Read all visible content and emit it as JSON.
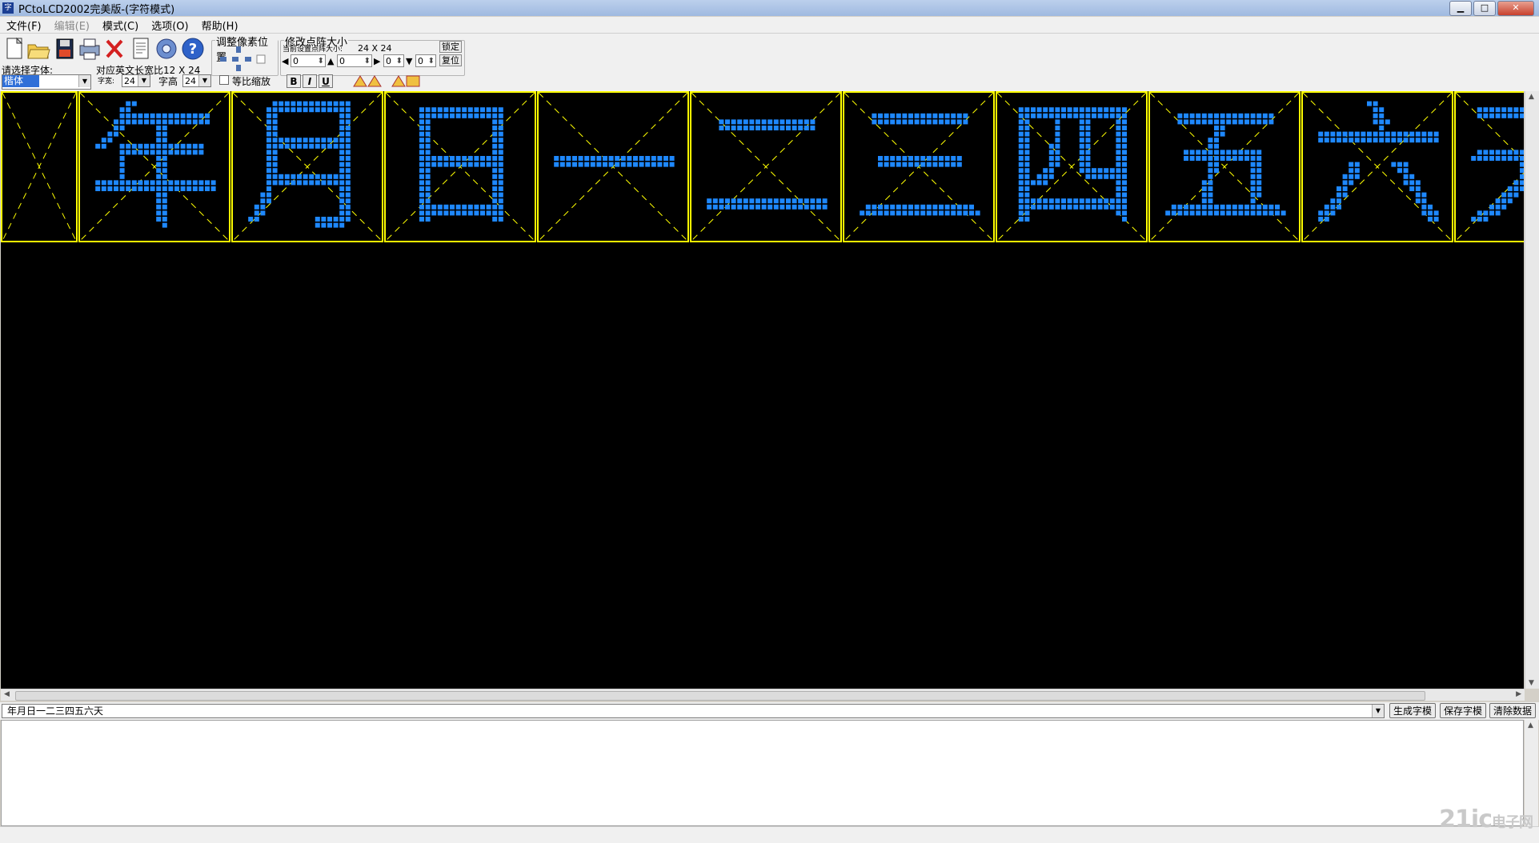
{
  "window": {
    "title": "PCtoLCD2002完美版-(字符模式)",
    "app_icon": "字"
  },
  "menu": [
    {
      "label": "文件(F)",
      "enabled": true
    },
    {
      "label": "编辑(E)",
      "enabled": false
    },
    {
      "label": "模式(C)",
      "enabled": true
    },
    {
      "label": "选项(O)",
      "enabled": true
    },
    {
      "label": "帮助(H)",
      "enabled": true
    }
  ],
  "toolbar": {
    "icons": [
      "new-file-icon",
      "open-folder-icon",
      "save-icon",
      "printer-icon",
      "delete-icon",
      "document-icon",
      "gear-icon",
      "help-icon"
    ],
    "choose_font_label": "请选择字体:",
    "font_value": "楷体",
    "ratio_label": "对应英文长宽比12 X 24",
    "char_width_label": "字宽:",
    "char_width_value": "24",
    "char_height_label": "字高",
    "char_height_value": "24",
    "proportional_label": "等比缩放",
    "bold_label": "B",
    "italic_label": "I",
    "underline_label": "U"
  },
  "pixel_adjust": {
    "title": "调整像素位置"
  },
  "dot_size": {
    "title": "修改点阵大小",
    "current_label": "当前设置点阵大小:",
    "current_value": "24 X 24",
    "lock_label": "锁定",
    "reset_label": "复位",
    "spin_values": [
      "0",
      "0",
      "0",
      "0"
    ]
  },
  "glyphs": [
    "",
    "年",
    "月",
    "日",
    "一",
    "二",
    "三",
    "四",
    "五",
    "六",
    "天"
  ],
  "text_input": {
    "value": "年月日一二三四五六天"
  },
  "actions": {
    "generate_label": "生成字模",
    "save_label": "保存字模",
    "clear_label": "清除数据"
  },
  "watermark": {
    "main": "21ic",
    "sub": "电子网"
  },
  "colors": {
    "grid_border": "#ffff00",
    "pixel": "#1e88ff",
    "canvas_bg": "#000000"
  }
}
